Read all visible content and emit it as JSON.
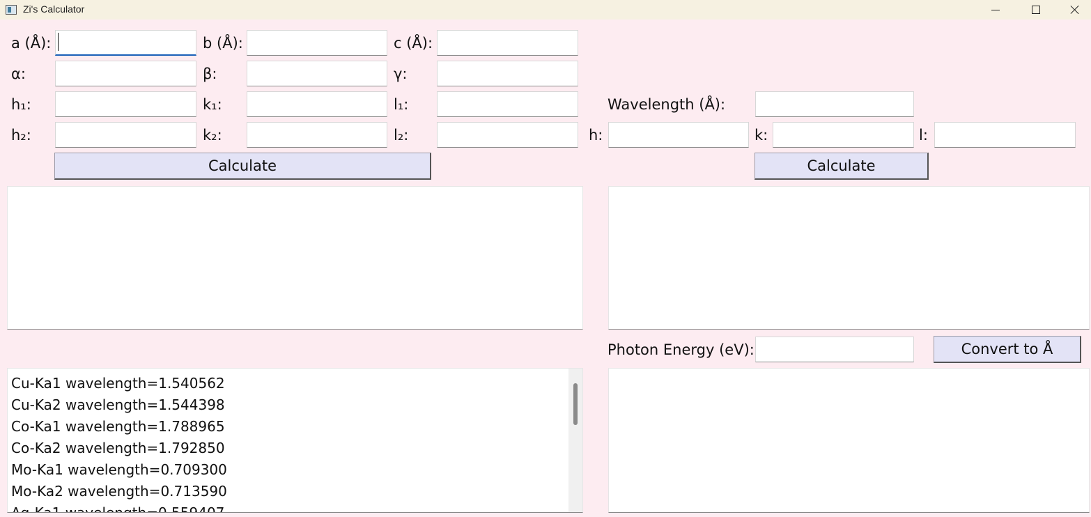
{
  "window": {
    "title": "Zi's Calculator"
  },
  "lattice": {
    "a_label": "a (Å):",
    "b_label": "b (Å):",
    "c_label": "c (Å):",
    "alpha_label": "α:",
    "beta_label": "β:",
    "gamma_label": "γ:",
    "h1_label": "h₁:",
    "k1_label": "k₁:",
    "l1_label": "l₁:",
    "h2_label": "h₂:",
    "k2_label": "k₂:",
    "l2_label": "l₂:",
    "a_value": "",
    "b_value": "",
    "c_value": "",
    "alpha_value": "",
    "beta_value": "",
    "gamma_value": "",
    "h1_value": "",
    "k1_value": "",
    "l1_value": "",
    "h2_value": "",
    "k2_value": "",
    "l2_value": "",
    "calculate_label": "Calculate",
    "output_text": ""
  },
  "diffraction": {
    "wavelength_label": "Wavelength (Å):",
    "wavelength_value": "",
    "h_label": "h:",
    "k_label": "k:",
    "l_label": "l:",
    "h_value": "",
    "k_value": "",
    "l_value": "",
    "calculate_label": "Calculate",
    "output_text": ""
  },
  "energy": {
    "photon_label": "Photon Energy (eV):",
    "photon_value": "",
    "convert_label": "Convert to Å",
    "output_text": ""
  },
  "wavelength_list": [
    "Cu-Ka1 wavelength=1.540562",
    "Cu-Ka2 wavelength=1.544398",
    "Co-Ka1 wavelength=1.788965",
    "Co-Ka2 wavelength=1.792850",
    "Mo-Ka1 wavelength=0.709300",
    "Mo-Ka2 wavelength=0.713590",
    "Ag-Ka1 wavelength=0.559407"
  ]
}
